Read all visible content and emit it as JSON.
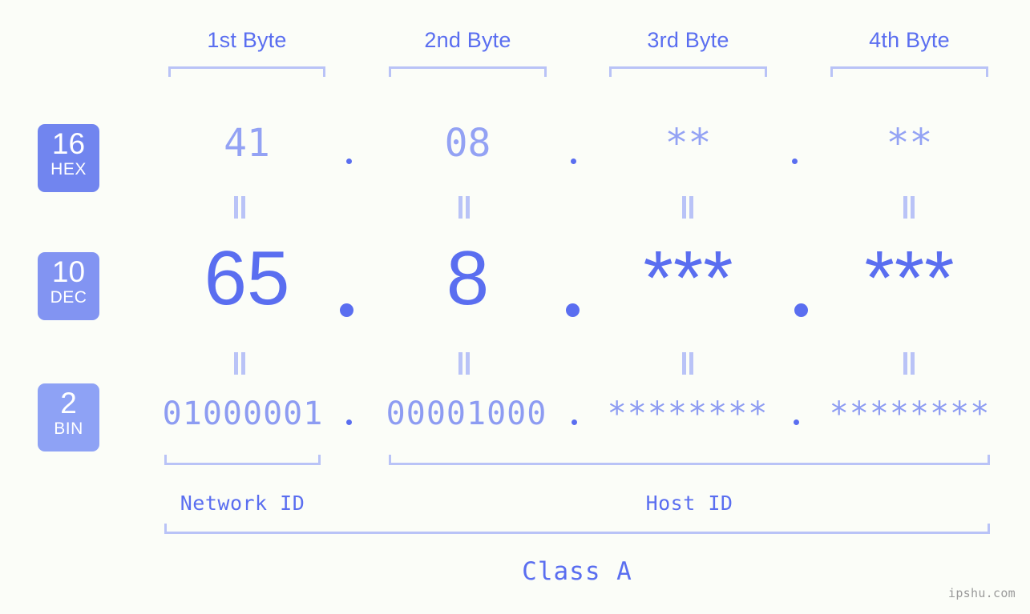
{
  "theme": {
    "background": "#fbfdf8",
    "accent_strong": "#5a6ef0",
    "accent_mid": "#8d9cf2",
    "accent_light": "#b9c3f7",
    "badge_hex_bg": "#7185ef",
    "badge_dec_bg": "#8294f2",
    "badge_bin_bg": "#8ea2f5",
    "watermark_color": "#9a9a9a"
  },
  "byte_headers": [
    {
      "label": "1st Byte"
    },
    {
      "label": "2nd Byte"
    },
    {
      "label": "3rd Byte"
    },
    {
      "label": "4th Byte"
    }
  ],
  "radix_badges": [
    {
      "number": "16",
      "name": "HEX"
    },
    {
      "number": "10",
      "name": "DEC"
    },
    {
      "number": "2",
      "name": "BIN"
    }
  ],
  "rows": {
    "hex": {
      "radix": "16",
      "radix_name": "HEX",
      "values": [
        "41",
        "08",
        "**",
        "**"
      ],
      "separator": "."
    },
    "dec": {
      "radix": "10",
      "radix_name": "DEC",
      "values": [
        "65",
        "8",
        "***",
        "***"
      ],
      "separator": "."
    },
    "bin": {
      "radix": "2",
      "radix_name": "BIN",
      "values": [
        "01000001",
        "00001000",
        "********",
        "********"
      ],
      "separator": "."
    }
  },
  "equals_marks": {
    "glyph": "=",
    "count_per_row": 4
  },
  "id_sections": [
    {
      "label": "Network ID"
    },
    {
      "label": "Host ID"
    }
  ],
  "class_section": {
    "label": "Class A"
  },
  "watermark": {
    "text": "ipshu.com"
  }
}
